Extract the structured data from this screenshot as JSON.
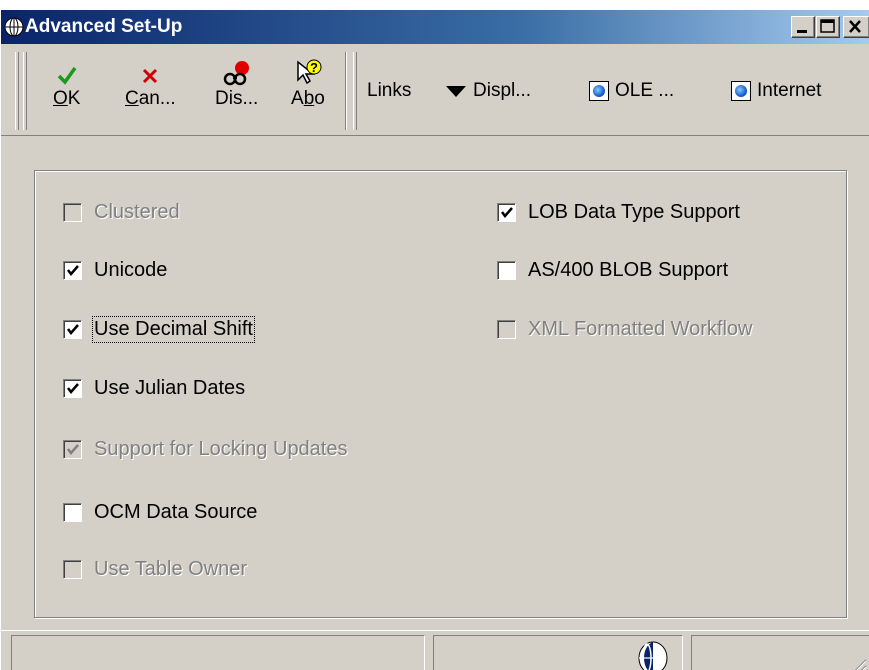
{
  "window": {
    "title": "Advanced Set-Up",
    "controls": {
      "minimize": "minimize-icon",
      "maximize": "maximize-icon",
      "close": "close-icon"
    }
  },
  "toolbar": {
    "ok": {
      "label_pre": "",
      "mnemonic": "O",
      "label_post": "K",
      "icon": "checkmark-icon"
    },
    "cancel": {
      "label_pre": "",
      "mnemonic": "C",
      "label_post": "an...",
      "icon": "x-icon"
    },
    "display": {
      "label": "Dis...",
      "icon": "binoculars-icon"
    },
    "about": {
      "label_pre": "A",
      "mnemonic": "b",
      "label_post": "o",
      "icon": "help-cursor-icon"
    },
    "links": "Links",
    "display_menu": "Displ...",
    "ole": "OLE ...",
    "internet": "Internet"
  },
  "options": {
    "left": [
      {
        "label": "Clustered",
        "checked": false,
        "disabled": true
      },
      {
        "label": "Unicode",
        "checked": true,
        "disabled": false
      },
      {
        "label": "Use Decimal Shift",
        "checked": true,
        "disabled": false,
        "focused": true
      },
      {
        "label": "Use Julian Dates",
        "checked": true,
        "disabled": false
      },
      {
        "label": "Support for Locking Updates",
        "checked": true,
        "disabled": true
      },
      {
        "label": "OCM Data Source",
        "checked": false,
        "disabled": false
      },
      {
        "label": "Use Table Owner",
        "checked": false,
        "disabled": true
      }
    ],
    "right": [
      {
        "label": "LOB Data Type Support",
        "checked": true,
        "disabled": false
      },
      {
        "label": "AS/400 BLOB Support",
        "checked": false,
        "disabled": false
      },
      {
        "label": "XML Formatted Workflow",
        "checked": false,
        "disabled": true
      }
    ]
  },
  "colors": {
    "face": "#d4d0c8",
    "title_start": "#0a246a",
    "title_end": "#a6caf0",
    "ok_green": "#1a9a1a",
    "cancel_red": "#d00000"
  }
}
